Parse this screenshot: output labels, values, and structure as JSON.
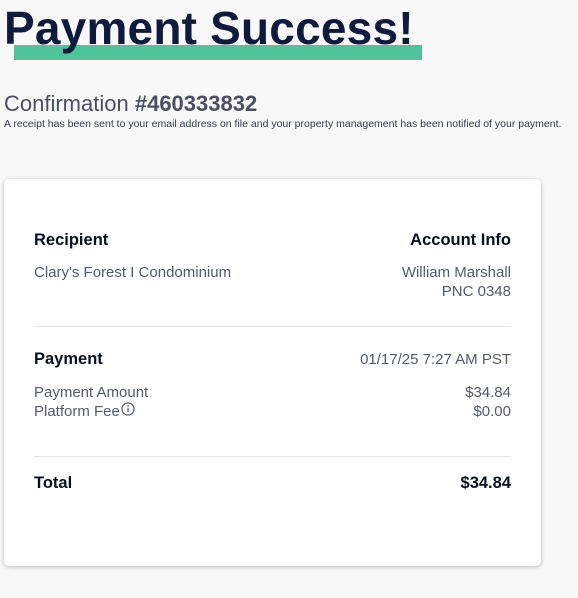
{
  "header": {
    "title": "Payment Success!",
    "confirmation_label": "Confirmation",
    "confirmation_number": "#460333832",
    "receipt_note": "A receipt has been sent to your email address on file and your property management has been notified of your payment."
  },
  "card": {
    "recipient_heading": "Recipient",
    "recipient_name": "Clary's Forest I Condominium",
    "account_heading": "Account Info",
    "account_name": "William Marshall",
    "account_number": "PNC 0348",
    "payment_heading": "Payment",
    "payment_datetime": "01/17/25 7:27 AM PST",
    "payment_amount_label": "Payment Amount",
    "payment_amount_value": "$34.84",
    "platform_fee_label": "Platform Fee",
    "platform_fee_value": "$0.00",
    "total_label": "Total",
    "total_value": "$34.84"
  },
  "colors": {
    "accent_underline": "#4fc49a",
    "title": "#0f1b3d",
    "background": "#f8f8f8"
  },
  "icons": {
    "platform_fee_info": "info-icon"
  }
}
